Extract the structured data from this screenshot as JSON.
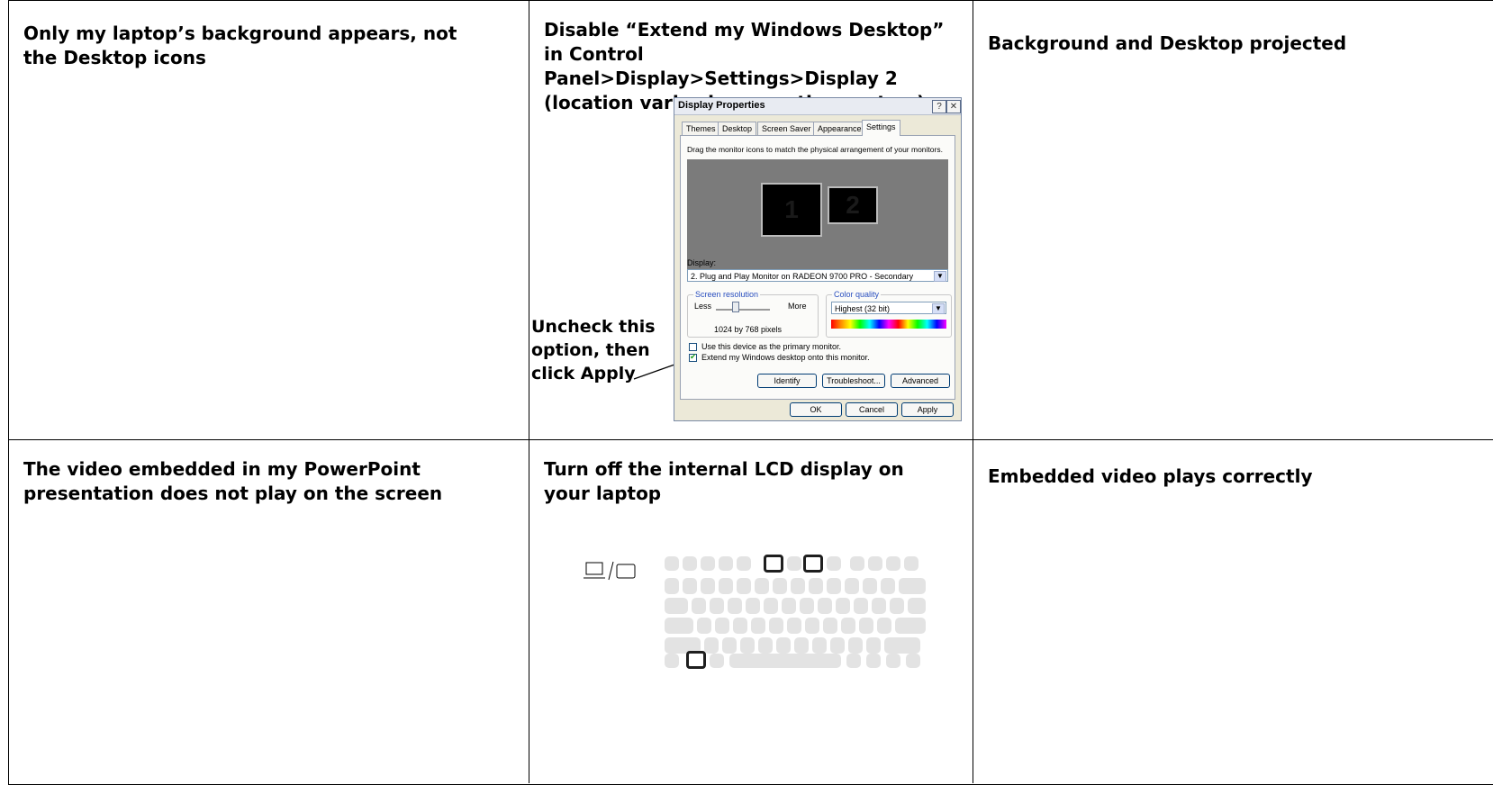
{
  "rows": [
    {
      "problem": "Only my laptop’s background appears, not the Desktop icons",
      "solution": "Disable “Extend my Windows Desktop” in Control Panel>Display>Settings>Display 2 (location varies by operating system)",
      "result": "Background and Desktop projected"
    },
    {
      "problem": "The video embedded in my PowerPoint presentation does not play on the screen",
      "solution": "Turn off the internal LCD display on your laptop",
      "result": "Embedded video plays correctly"
    }
  ],
  "callout": "Uncheck this option, then click Apply",
  "dialog": {
    "title": "Display Properties",
    "help_btn": "?",
    "close_btn": "✕",
    "tabs": [
      "Themes",
      "Desktop",
      "Screen Saver",
      "Appearance",
      "Settings"
    ],
    "active_tab": "Settings",
    "instruction": "Drag the monitor icons to match the physical arrangement of your monitors.",
    "monitor_1": "1",
    "monitor_2": "2",
    "display_label": "Display:",
    "display_value": "2. Plug and Play Monitor on RADEON 9700 PRO - Secondary",
    "screen_resolution_label": "Screen resolution",
    "less_label": "Less",
    "more_label": "More",
    "resolution_value": "1024 by 768 pixels",
    "color_quality_label": "Color quality",
    "color_quality_value": "Highest (32 bit)",
    "primary_checkbox_label": "Use this device as the primary monitor.",
    "primary_checked": false,
    "extend_checkbox_label": "Extend my Windows desktop onto this monitor.",
    "extend_checked": true,
    "buttons": {
      "identify": "Identify",
      "troubleshoot": "Troubleshoot...",
      "advanced": "Advanced",
      "ok": "OK",
      "cancel": "Cancel",
      "apply": "Apply"
    }
  },
  "keyboard": {
    "toggle_icon": "laptop-monitor-toggle-icon",
    "separator": "/"
  }
}
